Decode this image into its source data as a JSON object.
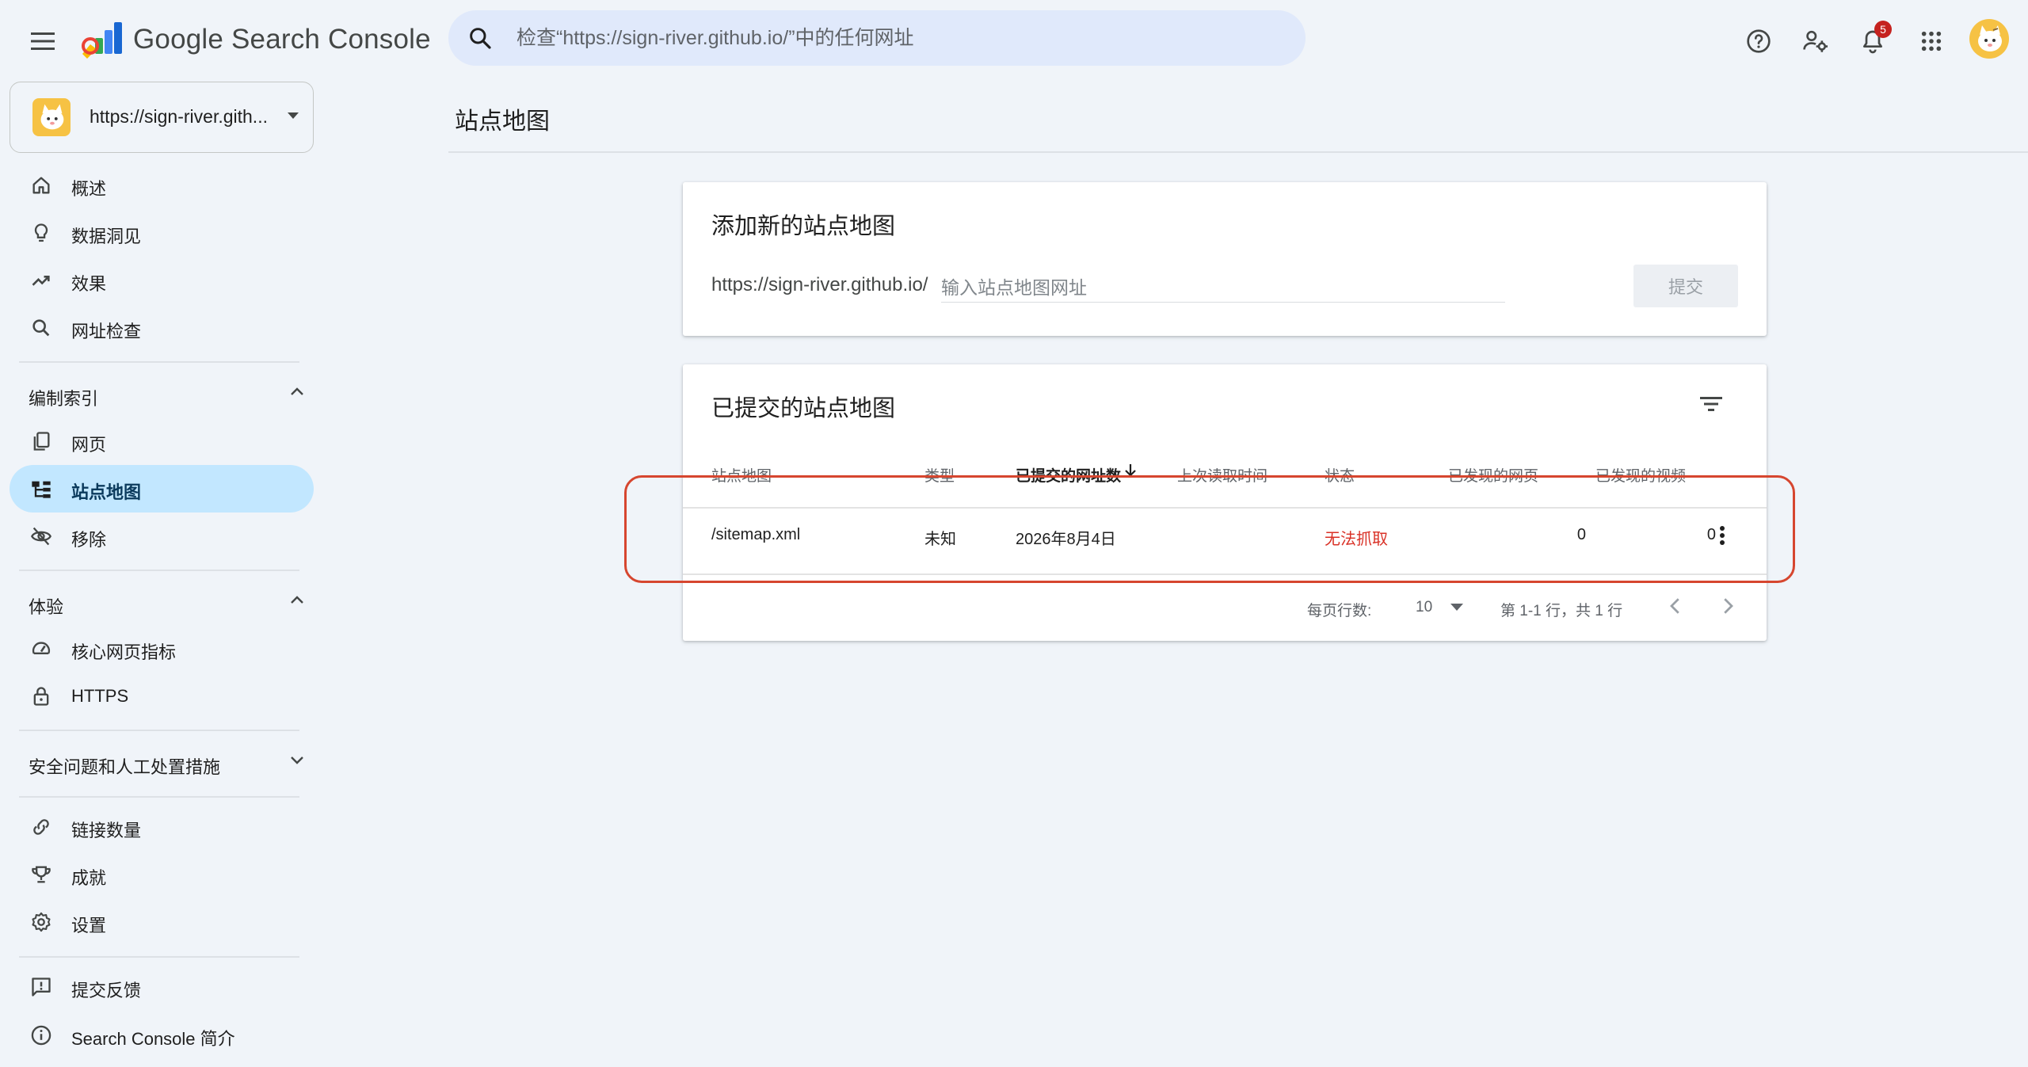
{
  "app": {
    "product_name": "Google Search Console",
    "search_placeholder": "检查“https://sign-river.github.io/”中的任何网址",
    "notifications_count": "5"
  },
  "property": {
    "url": "https://sign-river.gith..."
  },
  "nav": {
    "top_items": [
      {
        "label": "概述",
        "icon": "home-icon"
      },
      {
        "label": "数据洞见",
        "icon": "lightbulb-icon"
      },
      {
        "label": "效果",
        "icon": "trending-up-icon"
      },
      {
        "label": "网址检查",
        "icon": "search-icon"
      }
    ],
    "indexing": {
      "title": "编制索引",
      "items": [
        {
          "label": "网页",
          "icon": "pages-icon"
        },
        {
          "label": "站点地图",
          "icon": "sitemap-icon"
        },
        {
          "label": "移除",
          "icon": "visibility-off-icon"
        }
      ]
    },
    "experience": {
      "title": "体验",
      "items": [
        {
          "label": "核心网页指标",
          "icon": "speed-icon"
        },
        {
          "label": "HTTPS",
          "icon": "lock-icon"
        }
      ]
    },
    "security": {
      "title": "安全问题和人工处置措施"
    },
    "more_items": [
      {
        "label": "链接数量",
        "icon": "link-icon"
      },
      {
        "label": "成就",
        "icon": "trophy-icon"
      },
      {
        "label": "设置",
        "icon": "gear-icon"
      }
    ],
    "bottom_items": [
      {
        "label": "提交反馈",
        "icon": "feedback-icon"
      },
      {
        "label": "Search Console 简介",
        "icon": "info-icon"
      }
    ]
  },
  "page": {
    "title": "站点地图"
  },
  "add_sitemap": {
    "title": "添加新的站点地图",
    "prefix": "https://sign-river.github.io/",
    "placeholder": "输入站点地图网址",
    "submit_label": "提交"
  },
  "submitted": {
    "title": "已提交的站点地图",
    "columns": {
      "sitemap": "站点地图",
      "type": "类型",
      "submitted": "已提交的网址数",
      "last_read": "上次读取时间",
      "status": "状态",
      "pages": "已发现的网页",
      "videos": "已发现的视频"
    },
    "rows": [
      {
        "sitemap": "/sitemap.xml",
        "type": "未知",
        "submitted": "2026年8月4日",
        "last_read": "",
        "status": "无法抓取",
        "pages": "0",
        "videos": "0"
      }
    ],
    "pager": {
      "rows_label": "每页行数:",
      "rows_value": "10",
      "range": "第 1-1 行，共 1 行"
    }
  },
  "colors": {
    "accent_active": "#c2e7ff",
    "error": "#d93025",
    "highlight": "#d6462f",
    "background": "#f0f4f9"
  }
}
